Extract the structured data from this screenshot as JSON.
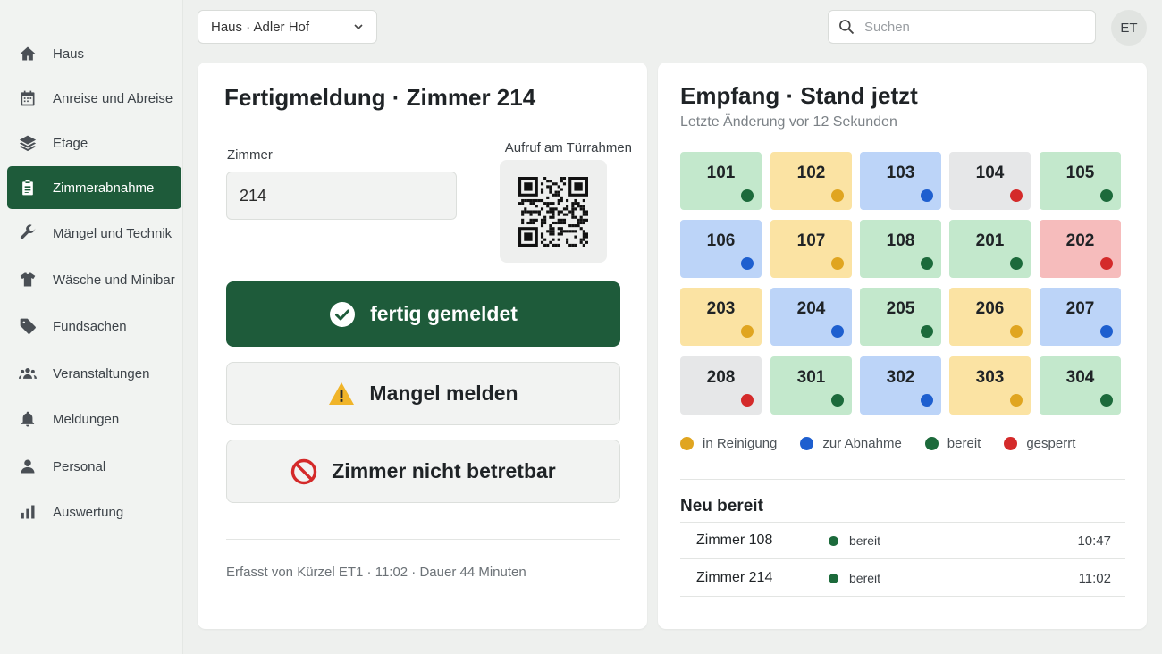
{
  "sidebar": {
    "items": [
      {
        "label": "Haus",
        "icon": "home-icon"
      },
      {
        "label": "Anreise und Abreise",
        "icon": "calendar-icon"
      },
      {
        "label": "Etage",
        "icon": "layers-icon"
      },
      {
        "label": "Zimmerabnahme",
        "icon": "clipboard-icon",
        "active": true
      },
      {
        "label": "Mängel und Technik",
        "icon": "wrench-icon"
      },
      {
        "label": "Wäsche und Minibar",
        "icon": "shirt-icon"
      },
      {
        "label": "Fundsachen",
        "icon": "tag-icon"
      },
      {
        "label": "Veranstaltungen",
        "icon": "people-icon"
      },
      {
        "label": "Meldungen",
        "icon": "bell-icon"
      },
      {
        "label": "Personal",
        "icon": "person-icon"
      },
      {
        "label": "Auswertung",
        "icon": "bar-chart-icon"
      }
    ]
  },
  "header": {
    "house_selector": "Haus · Adler Hof",
    "search_placeholder": "Suchen",
    "avatar_initials": "ET"
  },
  "report": {
    "title": "Fertigmeldung · Zimmer 214",
    "room_label": "Zimmer",
    "room_value": "214",
    "qr_label": "Aufruf am Türrahmen",
    "done_button": "fertig gemeldet",
    "defect_button": "Mangel melden",
    "blocked_button": "Zimmer nicht betretbar",
    "footer": "Erfasst von Kürzel ET1 · 11:02 · Dauer 44 Minuten"
  },
  "reception": {
    "title": "Empfang · Stand jetzt",
    "subtitle": "Letzte Änderung vor 12 Sekunden",
    "status_colors": {
      "cleaning": {
        "bg": "#fbe3a3",
        "dot": "#e0a520"
      },
      "inspection": {
        "bg": "#bcd4f8",
        "dot": "#1e5fcf"
      },
      "ready": {
        "bg": "#c3e8cc",
        "dot": "#1c6a3b"
      },
      "blocked_gray": {
        "bg": "#e6e7e8",
        "dot": "#d42a2a"
      },
      "blocked_red": {
        "bg": "#f6bcbc",
        "dot": "#d42a2a"
      }
    },
    "rooms": [
      {
        "number": "101",
        "status": "ready"
      },
      {
        "number": "102",
        "status": "cleaning"
      },
      {
        "number": "103",
        "status": "inspection"
      },
      {
        "number": "104",
        "status": "blocked_gray"
      },
      {
        "number": "105",
        "status": "ready"
      },
      {
        "number": "106",
        "status": "inspection"
      },
      {
        "number": "107",
        "status": "cleaning"
      },
      {
        "number": "108",
        "status": "ready"
      },
      {
        "number": "201",
        "status": "ready"
      },
      {
        "number": "202",
        "status": "blocked_red"
      },
      {
        "number": "203",
        "status": "cleaning"
      },
      {
        "number": "204",
        "status": "inspection"
      },
      {
        "number": "205",
        "status": "ready"
      },
      {
        "number": "206",
        "status": "cleaning"
      },
      {
        "number": "207",
        "status": "inspection"
      },
      {
        "number": "208",
        "status": "blocked_gray"
      },
      {
        "number": "301",
        "status": "ready"
      },
      {
        "number": "302",
        "status": "inspection"
      },
      {
        "number": "303",
        "status": "cleaning"
      },
      {
        "number": "304",
        "status": "ready"
      }
    ],
    "legend": [
      {
        "label": "in Reinigung",
        "color": "#e0a520"
      },
      {
        "label": "zur Abnahme",
        "color": "#1e5fcf"
      },
      {
        "label": "bereit",
        "color": "#1c6a3b"
      },
      {
        "label": "gesperrt",
        "color": "#d42a2a"
      }
    ],
    "new_ready": {
      "title": "Neu bereit",
      "rows": [
        {
          "room": "Zimmer 108",
          "status": "bereit",
          "time": "10:47"
        },
        {
          "room": "Zimmer 214",
          "status": "bereit",
          "time": "11:02"
        }
      ]
    }
  }
}
